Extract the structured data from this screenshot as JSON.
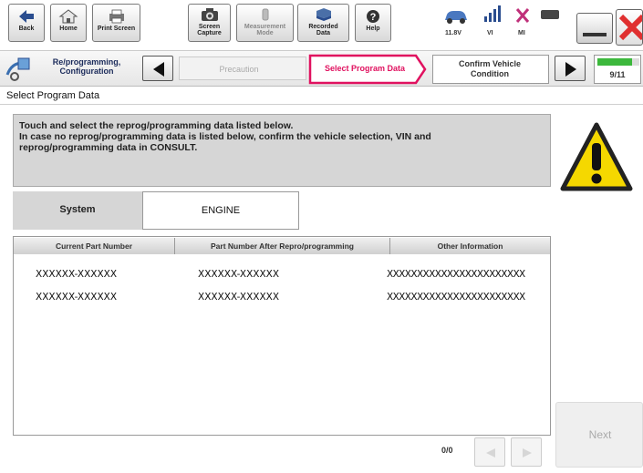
{
  "toolbar": {
    "buttons": [
      {
        "id": "back",
        "label": "Back",
        "icon": "back-arrow-icon"
      },
      {
        "id": "home",
        "label": "Home",
        "icon": "home-icon"
      },
      {
        "id": "print",
        "label": "Print Screen",
        "icon": "printer-icon"
      },
      {
        "id": "capture",
        "label": "Screen\nCapture",
        "icon": "camera-icon"
      },
      {
        "id": "measurement",
        "label": "Measurement\nMode",
        "icon": "measurement-icon"
      },
      {
        "id": "recorded",
        "label": "Recorded\nData",
        "icon": "recorded-data-icon"
      },
      {
        "id": "help",
        "label": "Help",
        "icon": "help-icon"
      }
    ],
    "status": {
      "voltage": "11.8V",
      "vi": "VI",
      "mi": "MI"
    }
  },
  "breadcrumb": {
    "root": "Re/programming,\nConfiguration",
    "steps": [
      "Precaution",
      "Select Program Data",
      "Confirm Vehicle\nCondition"
    ],
    "active_index": 1,
    "progress": "9/11",
    "progress_fraction": 0.82
  },
  "page_title": "Select Program Data",
  "message": {
    "line1": "Touch and select the reprog/programming data listed below.",
    "line2": "In case no reprog/programming data is listed below, confirm the vehicle selection, VIN and",
    "line3": "reprog/programming data in CONSULT."
  },
  "system": {
    "label": "System",
    "value": "ENGINE"
  },
  "table": {
    "headers": [
      "Current Part Number",
      "Part Number After Repro/programming",
      "Other Information"
    ],
    "rows": [
      [
        "XXXXXX-XXXXXX",
        "XXXXXX-XXXXXX",
        "XXXXXXXXXXXXXXXXXXXXXXX"
      ],
      [
        "XXXXXX-XXXXXX",
        "XXXXXX-XXXXXX",
        "XXXXXXXXXXXXXXXXXXXXXXX"
      ]
    ]
  },
  "pager": {
    "text": "0/0"
  },
  "next_label": "Next",
  "colors": {
    "active_step": "#e0115f",
    "progress_green": "#3cb83c",
    "close_red": "#e03030",
    "warning_yellow": "#f5d800"
  }
}
